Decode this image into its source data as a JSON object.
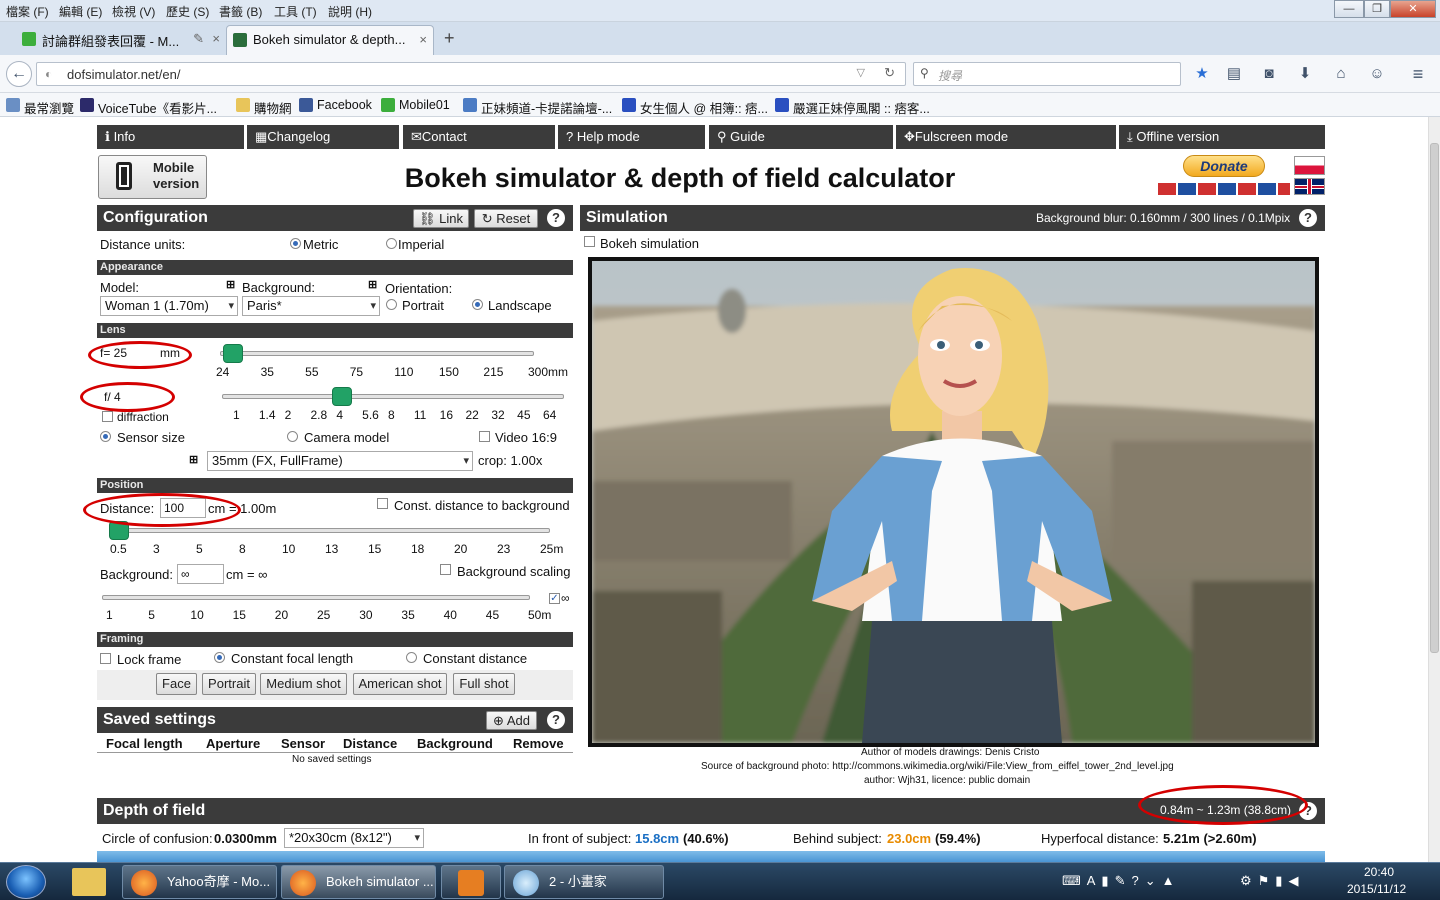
{
  "menubar": {
    "items": [
      "檔案 (F)",
      "編輯 (E)",
      "檢視 (V)",
      "歷史 (S)",
      "書籤 (B)",
      "工具 (T)",
      "說明 (H)"
    ]
  },
  "tabs": [
    {
      "label": "討論群組發表回覆 - M...",
      "active": false
    },
    {
      "label": "Bokeh simulator & depth...",
      "active": true
    }
  ],
  "nav": {
    "url": "dofsimulator.net/en/",
    "search_placeholder": "搜尋"
  },
  "bookmarks": [
    "最常瀏覽",
    "VoiceTube《看影片...",
    "購物網",
    "Facebook",
    "Mobile01",
    "正妹頻道-卡提諾論壇-...",
    "女生個人 @ 相簿:: 痞...",
    "嚴選正妹停風閣 :: 痞客..."
  ],
  "topnav": [
    "Info",
    "Changelog",
    "Contact",
    "Help mode",
    "Guide",
    "Fulscreen mode",
    "Offline version"
  ],
  "mobile_button": "Mobile version",
  "page_title": "Bokeh simulator & depth of field calculator",
  "donate": "Donate",
  "config": {
    "title": "Configuration",
    "link_btn": "Link",
    "reset_btn": "Reset",
    "distance_units_label": "Distance units:",
    "metric": "Metric",
    "imperial": "Imperial",
    "appearance": "Appearance",
    "model_label": "Model:",
    "model_value": "Woman 1 (1.70m)",
    "background_label": "Background:",
    "background_value": "Paris*",
    "orientation_label": "Orientation:",
    "portrait": "Portrait",
    "landscape": "Landscape",
    "lens": "Lens",
    "focal_value": "f= 25",
    "focal_unit": "mm",
    "focal_ticks": [
      "24",
      "35",
      "55",
      "75",
      "110",
      "150",
      "215",
      "300mm"
    ],
    "focal_slider": 0.04,
    "aperture_value": "f/ 4",
    "aperture_ticks": [
      "1",
      "1.4",
      "2",
      "2.8",
      "4",
      "5.6",
      "8",
      "11",
      "16",
      "22",
      "32",
      "45",
      "64"
    ],
    "aperture_slider": 0.35,
    "diffraction": "diffraction",
    "sensor_size": "Sensor size",
    "camera_model": "Camera model",
    "video": "Video 16:9",
    "sensor_value": "35mm (FX, FullFrame)",
    "crop": "crop: 1.00x",
    "position": "Position",
    "distance_label": "Distance:",
    "distance_value": "100",
    "distance_suffix": "cm = 1.00m",
    "const_distance": "Const. distance to background",
    "distance_ticks": [
      "0.5",
      "3",
      "5",
      "8",
      "10",
      "13",
      "15",
      "18",
      "20",
      "23",
      "25m"
    ],
    "distance_slider": 0.02,
    "bg_label": "Background:",
    "bg_value": "∞",
    "bg_suffix": "cm = ∞",
    "bg_scaling": "Background scaling",
    "bg_ticks": [
      "1",
      "5",
      "10",
      "15",
      "20",
      "25",
      "30",
      "35",
      "40",
      "45",
      "50m"
    ],
    "bg_inf": "∞",
    "framing": "Framing",
    "lock_frame": "Lock frame",
    "const_focal": "Constant focal length",
    "const_dist": "Constant distance",
    "shots": [
      "Face",
      "Portrait",
      "Medium shot",
      "American shot",
      "Full shot"
    ]
  },
  "saved": {
    "title": "Saved settings",
    "add_btn": "Add",
    "columns": [
      "Focal length",
      "Aperture",
      "Sensor",
      "Distance",
      "Background",
      "Remove"
    ],
    "empty": "No saved settings"
  },
  "simulation": {
    "title": "Simulation",
    "blur_info": "Background blur: 0.160mm / 300 lines / 0.1Mpix",
    "bokeh_label": "Bokeh simulation",
    "credit1": "Author of models drawings: Denis Cristo",
    "credit2": "Source of background photo: http://commons.wikimedia.org/wiki/File:View_from_eiffel_tower_2nd_level.jpg",
    "credit3": "author: Wjh31, licence: public domain"
  },
  "dof": {
    "title": "Depth of field",
    "range": "0.84m ~ 1.23m (38.8cm)",
    "coc_label": "Circle of confusion:",
    "coc_value": "0.0300mm",
    "coc_select": "*20x30cm (8x12\")",
    "front_label": "In front of subject:",
    "front_value": "15.8cm",
    "front_pct": "(40.6%)",
    "behind_label": "Behind subject:",
    "behind_value": "23.0cm",
    "behind_pct": "(59.4%)",
    "hyper_label": "Hyperfocal distance:",
    "hyper_value": "5.21m (>2.60m)"
  },
  "taskbar": {
    "tasks": [
      "Yahoo奇摩 - Mo...",
      "Bokeh simulator ...",
      "",
      "2 - 小畫家"
    ],
    "time": "20:40",
    "date": "2015/11/12"
  },
  "colors": {
    "accent_green": "#22a266",
    "header_dark": "#3b3b3b",
    "annotation_red": "#d40000",
    "front_blue": "#1a6fc4",
    "behind_orange": "#e88b00"
  }
}
